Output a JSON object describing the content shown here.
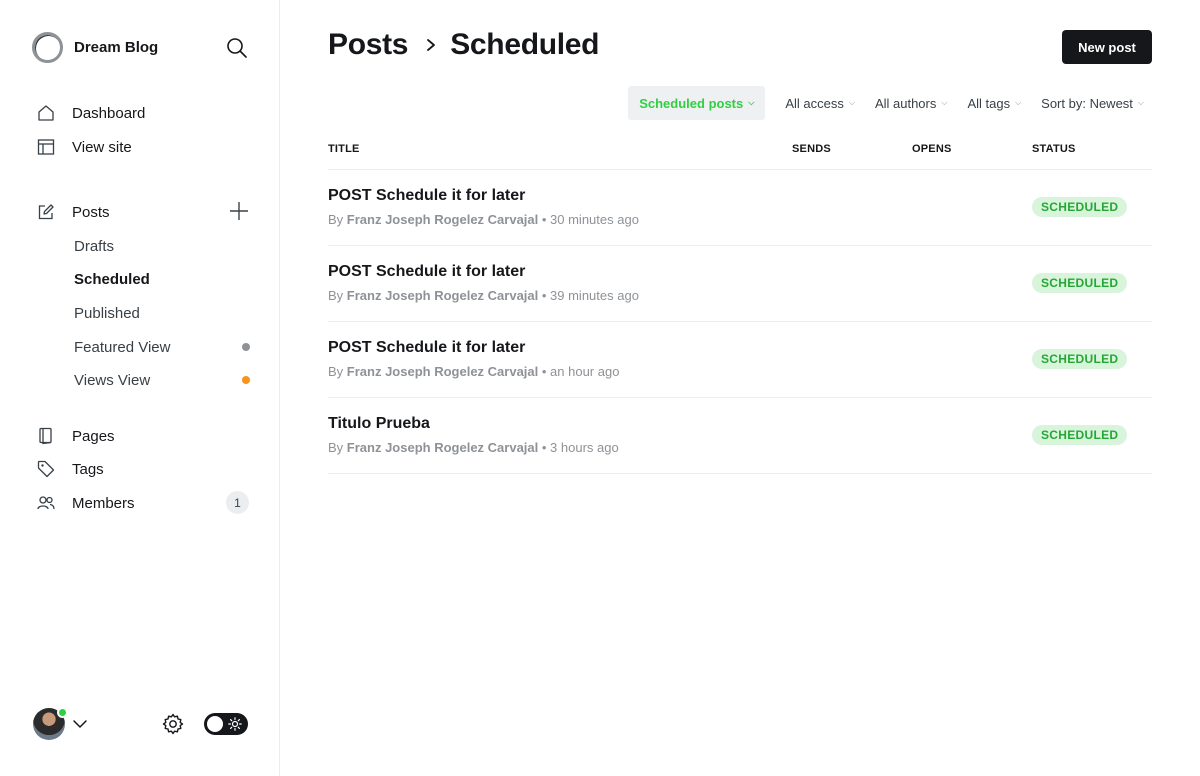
{
  "sidebar": {
    "brand": "Dream Blog",
    "items": [
      {
        "label": "Dashboard",
        "icon": "home-icon"
      },
      {
        "label": "View site",
        "icon": "layout-icon"
      },
      {
        "label": "Posts",
        "icon": "pencil-icon"
      },
      {
        "label": "Pages",
        "icon": "file-icon"
      },
      {
        "label": "Tags",
        "icon": "tag-icon"
      },
      {
        "label": "Members",
        "icon": "users-icon",
        "count": "1"
      }
    ],
    "post_subitems": [
      {
        "label": "Drafts"
      },
      {
        "label": "Scheduled",
        "active": true
      },
      {
        "label": "Published"
      },
      {
        "label": "Featured View",
        "dot_color": "#8e9297"
      },
      {
        "label": "Views View",
        "dot_color": "#f7941d"
      }
    ]
  },
  "header": {
    "section": "Posts",
    "current": "Scheduled",
    "new_post_label": "New post"
  },
  "filters": [
    {
      "label": "Scheduled posts",
      "active": true
    },
    {
      "label": "All access"
    },
    {
      "label": "All authors"
    },
    {
      "label": "All tags"
    },
    {
      "label": "Sort by: Newest"
    }
  ],
  "table": {
    "columns": [
      "TITLE",
      "SENDS",
      "OPENS",
      "STATUS"
    ],
    "rows": [
      {
        "title": "POST Schedule it for later",
        "by": "By",
        "author": "Franz Joseph Rogelez Carvajal",
        "time": "30 minutes ago",
        "status": "SCHEDULED"
      },
      {
        "title": "POST Schedule it for later",
        "by": "By",
        "author": "Franz Joseph Rogelez Carvajal",
        "time": "39 minutes ago",
        "status": "SCHEDULED"
      },
      {
        "title": "POST Schedule it for later",
        "by": "By",
        "author": "Franz Joseph Rogelez Carvajal",
        "time": "an hour ago",
        "status": "SCHEDULED"
      },
      {
        "title": "Titulo Prueba",
        "by": "By",
        "author": "Franz Joseph Rogelez Carvajal",
        "time": "3 hours ago",
        "status": "SCHEDULED"
      }
    ]
  },
  "colors": {
    "accent": "#30cf43",
    "status_bg": "#d8f5dc",
    "status_text": "#27a637",
    "primary_button": "#15171a"
  }
}
